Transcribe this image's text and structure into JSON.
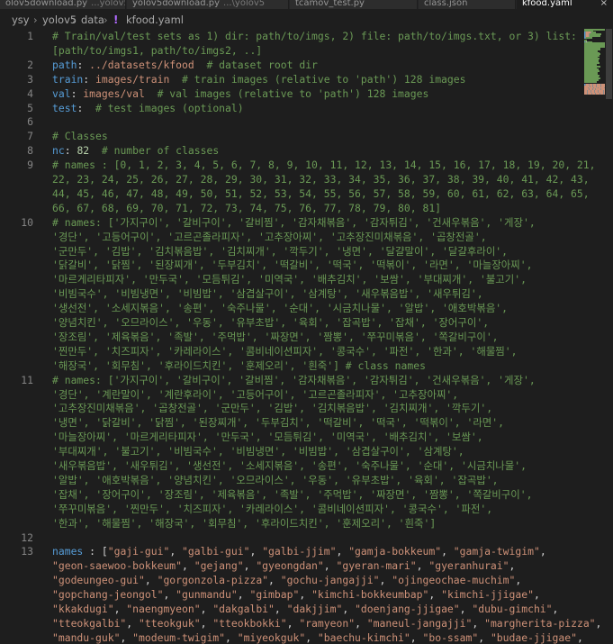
{
  "tabs": [
    {
      "label": "olov5download.py",
      "hint": "...yolov5",
      "active": false,
      "icon": "python-file-icon"
    },
    {
      "label": "yolov5download.py",
      "hint": "...\\yolov5",
      "active": false,
      "icon": "python-file-icon"
    },
    {
      "label": "tcamov_test.py",
      "hint": "",
      "active": false,
      "icon": "python-file-icon"
    },
    {
      "label": "class.json",
      "hint": "",
      "active": false,
      "icon": "json-file-icon"
    },
    {
      "label": "kfood.yaml",
      "hint": "",
      "active": true,
      "icon": "yaml-file-icon"
    }
  ],
  "tab_close_glyph": "×",
  "breadcrumb": {
    "separator": "›",
    "items": [
      "ysy",
      "yolov5",
      "data",
      "kfood.yaml"
    ],
    "file_icon": "yaml-file-icon",
    "file_icon_glyph": "!"
  },
  "colors": {
    "background": "#1e1e1e",
    "comment": "#6a9955",
    "key": "#569cd6",
    "string": "#ce9178",
    "number": "#b5cea8",
    "plain": "#d4d4d4",
    "line_number": "#858585"
  },
  "lines": [
    {
      "n": "1",
      "t": [
        [
          "comment",
          "# Train/val/test sets as 1) dir: path/to/imgs, 2) file: path/to/imgs.txt, or 3) list:"
        ]
      ]
    },
    {
      "n": "",
      "t": [
        [
          "comment",
          "[path/to/imgs1, path/to/imgs2, ..]"
        ]
      ]
    },
    {
      "n": "2",
      "t": [
        [
          "key",
          "path"
        ],
        [
          "plain",
          ": "
        ],
        [
          "str",
          "../datasets/kfood"
        ],
        [
          "plain",
          "  "
        ],
        [
          "comment",
          "# dataset root dir"
        ]
      ]
    },
    {
      "n": "3",
      "t": [
        [
          "key",
          "train"
        ],
        [
          "plain",
          ": "
        ],
        [
          "str",
          "images/train"
        ],
        [
          "plain",
          "  "
        ],
        [
          "comment",
          "# train images (relative to 'path') 128 images"
        ]
      ]
    },
    {
      "n": "4",
      "t": [
        [
          "key",
          "val"
        ],
        [
          "plain",
          ": "
        ],
        [
          "str",
          "images/val"
        ],
        [
          "plain",
          "  "
        ],
        [
          "comment",
          "# val images (relative to 'path') 128 images"
        ]
      ]
    },
    {
      "n": "5",
      "t": [
        [
          "key",
          "test"
        ],
        [
          "plain",
          ":  "
        ],
        [
          "comment",
          "# test images (optional)"
        ]
      ]
    },
    {
      "n": "6",
      "t": []
    },
    {
      "n": "7",
      "t": [
        [
          "comment",
          "# Classes"
        ]
      ]
    },
    {
      "n": "8",
      "t": [
        [
          "key",
          "nc"
        ],
        [
          "plain",
          ": "
        ],
        [
          "num",
          "82"
        ],
        [
          "plain",
          "  "
        ],
        [
          "comment",
          "# number of classes"
        ]
      ]
    },
    {
      "n": "9",
      "t": [
        [
          "comment",
          "# names : [0, 1, 2, 3, 4, 5, 6, 7, 8, 9, 10, 11, 12, 13, 14, 15, 16, 17, 18, 19, 20, 21,"
        ]
      ]
    },
    {
      "n": "",
      "t": [
        [
          "comment",
          "22, 23, 24, 25, 26, 27, 28, 29, 30, 31, 32, 33, 34, 35, 36, 37, 38, 39, 40, 41, 42, 43,"
        ]
      ]
    },
    {
      "n": "",
      "t": [
        [
          "comment",
          "44, 45, 46, 47, 48, 49, 50, 51, 52, 53, 54, 55, 56, 57, 58, 59, 60, 61, 62, 63, 64, 65,"
        ]
      ]
    },
    {
      "n": "",
      "t": [
        [
          "comment",
          "66, 67, 68, 69, 70, 71, 72, 73, 74, 75, 76, 77, 78, 79, 80, 81]"
        ]
      ]
    },
    {
      "n": "10",
      "t": [
        [
          "comment",
          "# names: ['가지구이', '갈비구이', '갈비찜', '감자채볶음', '감자튀김', '건새우볶음', '게장',"
        ]
      ]
    },
    {
      "n": "",
      "t": [
        [
          "comment",
          "'경단', '고등어구이', '고르곤졸라피자', '고추장아찌', '고추장진미채볶음', '곱창전골',"
        ]
      ]
    },
    {
      "n": "",
      "t": [
        [
          "comment",
          "'군만두', '김밥', '김치볶음밥', '김치찌개', '깍두기', '냉면', '달걀말이', '달걀후라이',"
        ]
      ]
    },
    {
      "n": "",
      "t": [
        [
          "comment",
          "'닭갈비', '닭찜', '된장찌개', '두부김치', '떡갈비', '떡국', '떡볶이', '라면', '마늘장아찌',"
        ]
      ]
    },
    {
      "n": "",
      "t": [
        [
          "comment",
          "'마르게리타피자', '만두국', '모듬튀김', '미역국', '배추김치', '보쌈', '부대찌개', '불고기',"
        ]
      ]
    },
    {
      "n": "",
      "t": [
        [
          "comment",
          "'비빔국수', '비빔냉면', '비빔밥', '삼겹살구이', '삼계탕', '새우볶음밥', '새우튀김',"
        ]
      ]
    },
    {
      "n": "",
      "t": [
        [
          "comment",
          "'생선전', '소세지볶음', '송편', '숙주나물', '순대', '시금치나물', '알밥', '애호박볶음',"
        ]
      ]
    },
    {
      "n": "",
      "t": [
        [
          "comment",
          "'양념치킨', '오므라이스', '우동', '유부초밥', '육회', '잡곡밥', '잡채', '장어구이',"
        ]
      ]
    },
    {
      "n": "",
      "t": [
        [
          "comment",
          "'장조림', '제육볶음', '족발', '주먹밥', '짜장면', '짬뽕', '쭈꾸미볶음', '쪽갈비구이',"
        ]
      ]
    },
    {
      "n": "",
      "t": [
        [
          "comment",
          "'찐만두', '치즈피자', '카레라이스', '콤비네이션피자', '콩국수', '파전', '한과', '해물찜',"
        ]
      ]
    },
    {
      "n": "",
      "t": [
        [
          "comment",
          "'해장국', '회무침', '후라이드치킨', '훈제오리', '흰죽'] # class names"
        ]
      ]
    },
    {
      "n": "11",
      "t": [
        [
          "comment",
          "# names: ['가지구이', '갈비구이', '갈비찜', '감자채볶음', '감자튀김', '건새우볶음', '게장',"
        ]
      ]
    },
    {
      "n": "",
      "t": [
        [
          "comment",
          "'경단', '계란말이', '계란후라이', '고등어구이', '고르곤졸라피자', '고추장아찌',"
        ]
      ]
    },
    {
      "n": "",
      "t": [
        [
          "comment",
          "'고추장진미채볶음', '곱창전골', '군만두', '김밥', '김치볶음밥', '김치찌개', '깍두기',"
        ]
      ]
    },
    {
      "n": "",
      "t": [
        [
          "comment",
          "'냉면', '닭갈비', '닭찜', '된장찌개', '두부김치', '떡갈비', '떡국', '떡볶이', '라면',"
        ]
      ]
    },
    {
      "n": "",
      "t": [
        [
          "comment",
          "'마늘장아찌', '마르게리타피자', '만두국', '모듬튀김', '미역국', '배추김치', '보쌈',"
        ]
      ]
    },
    {
      "n": "",
      "t": [
        [
          "comment",
          "'부대찌개', '불고기', '비빔국수', '비빔냉면', '비빔밥', '삼겹살구이', '삼계탕',"
        ]
      ]
    },
    {
      "n": "",
      "t": [
        [
          "comment",
          "'새우볶음밥', '새우튀김', '생선전', '소세지볶음', '송편', '숙주나물', '순대', '시금치나물',"
        ]
      ]
    },
    {
      "n": "",
      "t": [
        [
          "comment",
          "'알밥', '애호박볶음', '양념치킨', '오므라이스', '우동', '유부초밥', '육회', '잡곡밥',"
        ]
      ]
    },
    {
      "n": "",
      "t": [
        [
          "comment",
          "'잡채', '장어구이', '장조림', '제육볶음', '족발', '주먹밥', '짜장면', '짬뽕', '쪽갈비구이',"
        ]
      ]
    },
    {
      "n": "",
      "t": [
        [
          "comment",
          "'쭈꾸미볶음', '찐만두', '치즈피자', '카레라이스', '콤비네이션피자', '콩국수', '파전',"
        ]
      ]
    },
    {
      "n": "",
      "t": [
        [
          "comment",
          "'한과', '해물찜', '해장국', '회무침', '후라이드치킨', '훈제오리', '흰죽']"
        ]
      ]
    },
    {
      "n": "12",
      "t": []
    },
    {
      "n": "13",
      "t": [
        [
          "key",
          "names"
        ],
        [
          "plain",
          " : ["
        ],
        [
          "str",
          "\"gaji-gui\""
        ],
        [
          "plain",
          ", "
        ],
        [
          "str",
          "\"galbi-gui\""
        ],
        [
          "plain",
          ", "
        ],
        [
          "str",
          "\"galbi-jjim\""
        ],
        [
          "plain",
          ", "
        ],
        [
          "str",
          "\"gamja-bokkeum\""
        ],
        [
          "plain",
          ", "
        ],
        [
          "str",
          "\"gamja-twigim\""
        ],
        [
          "plain",
          ","
        ]
      ]
    },
    {
      "n": "",
      "t": [
        [
          "str",
          "\"geon-saewoo-bokkeum\""
        ],
        [
          "plain",
          ", "
        ],
        [
          "str",
          "\"gejang\""
        ],
        [
          "plain",
          ", "
        ],
        [
          "str",
          "\"gyeongdan\""
        ],
        [
          "plain",
          ", "
        ],
        [
          "str",
          "\"gyeran-mari\""
        ],
        [
          "plain",
          ", "
        ],
        [
          "str",
          "\"gyeranhurai\""
        ],
        [
          "plain",
          ","
        ]
      ]
    },
    {
      "n": "",
      "t": [
        [
          "str",
          "\"godeungeo-gui\""
        ],
        [
          "plain",
          ", "
        ],
        [
          "str",
          "\"gorgonzola-pizza\""
        ],
        [
          "plain",
          ", "
        ],
        [
          "str",
          "\"gochu-jangajji\""
        ],
        [
          "plain",
          ", "
        ],
        [
          "str",
          "\"ojingeochae-muchim\""
        ],
        [
          "plain",
          ","
        ]
      ]
    },
    {
      "n": "",
      "t": [
        [
          "str",
          "\"gopchang-jeongol\""
        ],
        [
          "plain",
          ", "
        ],
        [
          "str",
          "\"gunmandu\""
        ],
        [
          "plain",
          ", "
        ],
        [
          "str",
          "\"gimbap\""
        ],
        [
          "plain",
          ", "
        ],
        [
          "str",
          "\"kimchi-bokkeumbap\""
        ],
        [
          "plain",
          ", "
        ],
        [
          "str",
          "\"kimchi-jjigae\""
        ],
        [
          "plain",
          ","
        ]
      ]
    },
    {
      "n": "",
      "t": [
        [
          "str",
          "\"kkakdugi\""
        ],
        [
          "plain",
          ", "
        ],
        [
          "str",
          "\"naengmyeon\""
        ],
        [
          "plain",
          ", "
        ],
        [
          "str",
          "\"dakgalbi\""
        ],
        [
          "plain",
          ", "
        ],
        [
          "str",
          "\"dakjjim\""
        ],
        [
          "plain",
          ", "
        ],
        [
          "str",
          "\"doenjang-jjigae\""
        ],
        [
          "plain",
          ", "
        ],
        [
          "str",
          "\"dubu-gimchi\""
        ],
        [
          "plain",
          ","
        ]
      ]
    },
    {
      "n": "",
      "t": [
        [
          "str",
          "\"tteokgalbi\""
        ],
        [
          "plain",
          ", "
        ],
        [
          "str",
          "\"tteokguk\""
        ],
        [
          "plain",
          ", "
        ],
        [
          "str",
          "\"tteokbokki\""
        ],
        [
          "plain",
          ", "
        ],
        [
          "str",
          "\"ramyeon\""
        ],
        [
          "plain",
          ", "
        ],
        [
          "str",
          "\"maneul-jangajji\""
        ],
        [
          "plain",
          ", "
        ],
        [
          "str",
          "\"margherita-pizza\""
        ],
        [
          "plain",
          ","
        ]
      ]
    },
    {
      "n": "",
      "t": [
        [
          "str",
          "\"mandu-guk\""
        ],
        [
          "plain",
          ", "
        ],
        [
          "str",
          "\"modeum-twigim\""
        ],
        [
          "plain",
          ", "
        ],
        [
          "str",
          "\"miyeokguk\""
        ],
        [
          "plain",
          ", "
        ],
        [
          "str",
          "\"baechu-kimchi\""
        ],
        [
          "plain",
          ", "
        ],
        [
          "str",
          "\"bo-ssam\""
        ],
        [
          "plain",
          ", "
        ],
        [
          "str",
          "\"budae-jjigae\""
        ],
        [
          "plain",
          ","
        ]
      ]
    }
  ]
}
